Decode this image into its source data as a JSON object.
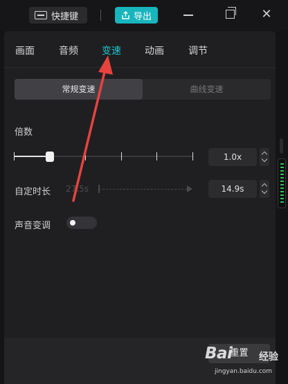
{
  "topbar": {
    "shortcut_label": "快捷键",
    "export_label": "导出"
  },
  "tabs": [
    {
      "label": "画面",
      "active": false
    },
    {
      "label": "音频",
      "active": false
    },
    {
      "label": "变速",
      "active": true
    },
    {
      "label": "动画",
      "active": false
    },
    {
      "label": "调节",
      "active": false
    }
  ],
  "speed_mode": {
    "options": [
      "常规变速",
      "曲线变速"
    ],
    "selected": "常规变速"
  },
  "speed": {
    "label": "倍数",
    "value": "1.0x",
    "slider_ticks": 5,
    "slider_level": 0.2
  },
  "duration": {
    "label": "自定时长",
    "original": "27.5s",
    "value": "14.9s"
  },
  "pitch": {
    "label": "声音变调",
    "enabled": false
  },
  "footer": {
    "reset_label": "重置"
  },
  "watermark": {
    "logo": "Bai",
    "text": "经验",
    "url": "jingyan.baidu.com"
  },
  "colors": {
    "accent": "#1fc5cf",
    "export_button": "#18b5bd",
    "annotation_arrow": "#e8433e"
  }
}
